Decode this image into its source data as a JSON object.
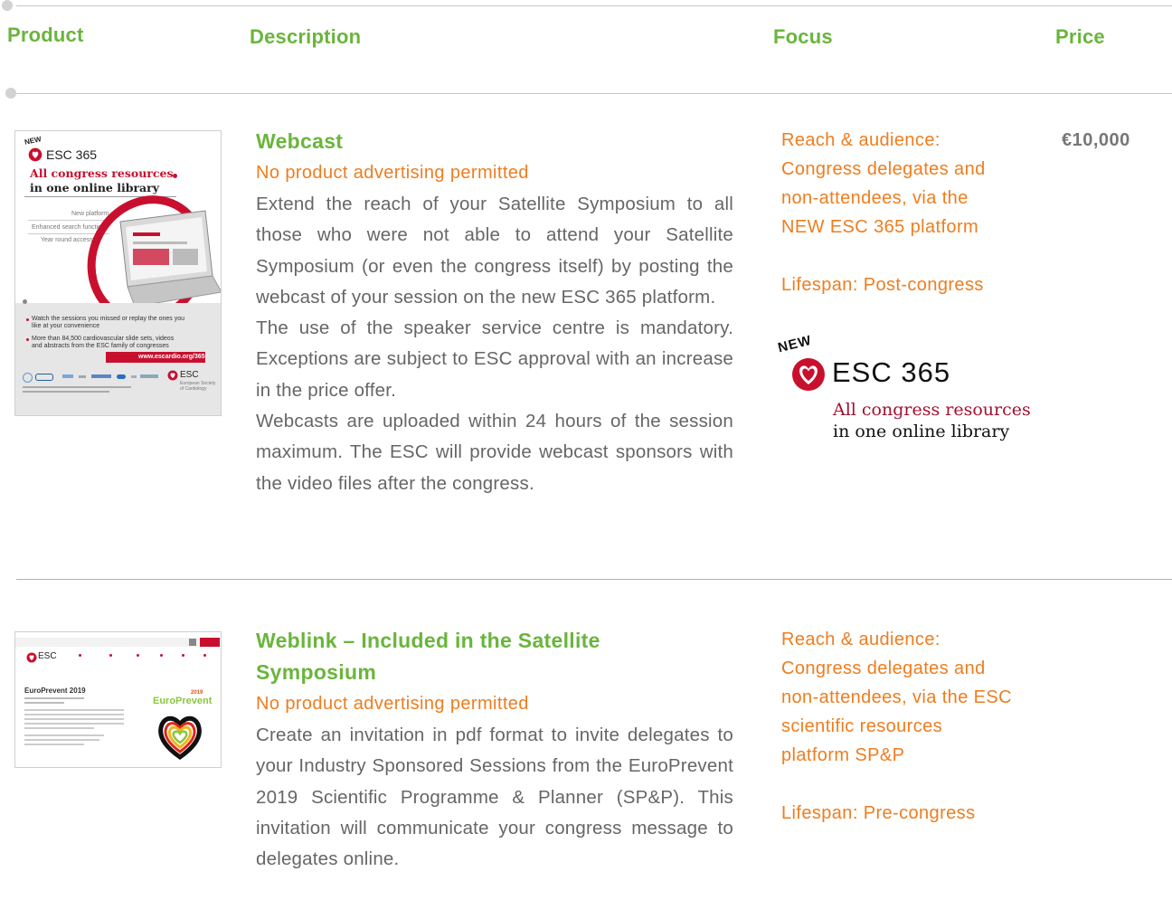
{
  "header": {
    "product": "Product",
    "description": "Description",
    "focus": "Focus",
    "price": "Price"
  },
  "rows": [
    {
      "title": "Webcast",
      "subtitle": "No product advertising permitted",
      "paragraphs": [
        "Extend the reach of your Satellite Symposium to all those who were not able to attend your Satellite Symposium (or even the congress itself) by posting the webcast of your session on the new ESC 365 platform.",
        "The use of the speaker service centre is mandatory. Exceptions are subject to ESC approval with an increase in the price offer.",
        "Webcasts are uploaded within 24 hours of the session maximum. The ESC will provide webcast sponsors with the video files after the congress."
      ],
      "focus_reach": "Reach & audience: Congress delegates and non-attendees, via the NEW ESC 365 platform",
      "focus_lifespan": "Lifespan: Post-congress",
      "price": "€10,000",
      "thumbnail": {
        "new_badge": "NEW",
        "brand": "ESC 365",
        "headline_line1": "All congress resources",
        "headline_line2": "in one online library",
        "features": [
          "New platform",
          "Enhanced search function",
          "Year round access"
        ],
        "bullets": [
          "Watch the sessions you missed or replay the ones you like at your convenience",
          "More than 84,500 cardiovascular slide sets, videos and abstracts from the ESC family of congresses"
        ],
        "url": "www.escardio.org/365",
        "footer_brand": "ESC",
        "footer_sub": "European Society of Cardiology"
      },
      "logo": {
        "new_badge": "NEW",
        "brand": "ESC 365",
        "line1": "All congress resources",
        "line2": "in one online library"
      }
    },
    {
      "title": "Weblink – Included in the Satellite Symposium",
      "subtitle": "No product advertising permitted",
      "paragraphs": [
        "Create an invitation in pdf format to invite delegates to your Industry Sponsored Sessions from the EuroPrevent 2019 Scientific Programme & Planner (SP&P). This invitation will communicate your congress message to delegates online."
      ],
      "focus_reach": "Reach & audience: Congress delegates and non-attendees, via the ESC scientific resources platform SP&P",
      "focus_lifespan": "Lifespan: Pre-congress",
      "price": "",
      "thumbnail": {
        "brand": "ESC",
        "page_title": "EuroPrevent 2019",
        "event_logo": "EuroPrevent",
        "event_year": "2019"
      }
    }
  ],
  "colors": {
    "green": "#6ab53c",
    "orange": "#ee7d1f",
    "esc_red": "#c8102e",
    "body_text": "#666666"
  }
}
